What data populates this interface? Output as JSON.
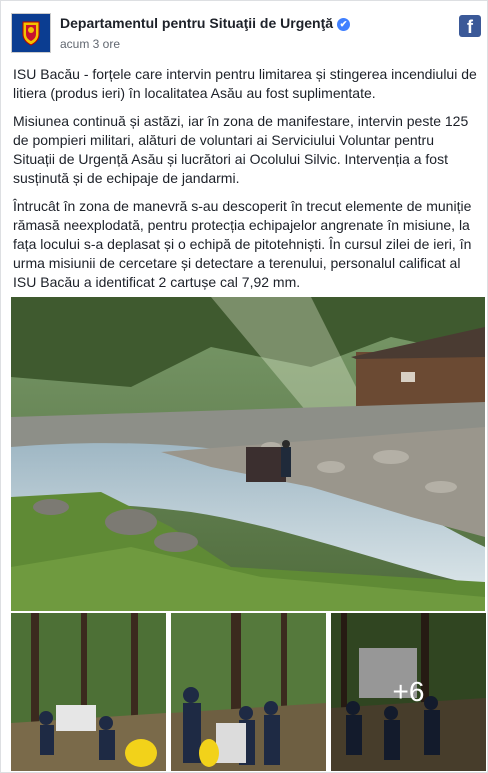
{
  "header": {
    "page_name": "Departamentul pentru Situaţii de Urgenţă",
    "verified_mark": "✔",
    "timestamp": "acum 3 ore",
    "logo_letter": "f"
  },
  "post": {
    "paragraphs": [
      "ISU Bacău - forțele care intervin pentru limitarea și stingerea incendiului de litiera (produs ieri) în localitatea Asău au fost suplimentate.",
      "Misiunea continuă și astăzi, iar în zona de manifestare, intervin peste 125 de pompieri militari, alături de voluntari ai Serviciului Voluntar pentru Situații de Urgență Asău și lucrători ai Ocolului Silvic. Intervenția a fost susținută și de echipaje de jandarmi.",
      "Întrucât în zona de manevră s-au descoperit în trecut elemente de muniție rămasă neexplodată, pentru protecția echipajelor angrenate în misiune, la fața locului s-a deplasat și o echipă de pitotehniști. În cursul zilei de ieri, în urma misiunii de cercetare și detectare a terenului, personalul calificat al ISU Bacău a identificat 2 cartușe cal 7,92 mm."
    ]
  },
  "photos": {
    "more_count": "+6"
  },
  "colors": {
    "brand": "#3b5998",
    "verified": "#4080ff",
    "text": "#1d2129",
    "muted": "#616770"
  },
  "icons": [
    "coat-of-arms-icon",
    "verified-icon",
    "facebook-icon"
  ]
}
